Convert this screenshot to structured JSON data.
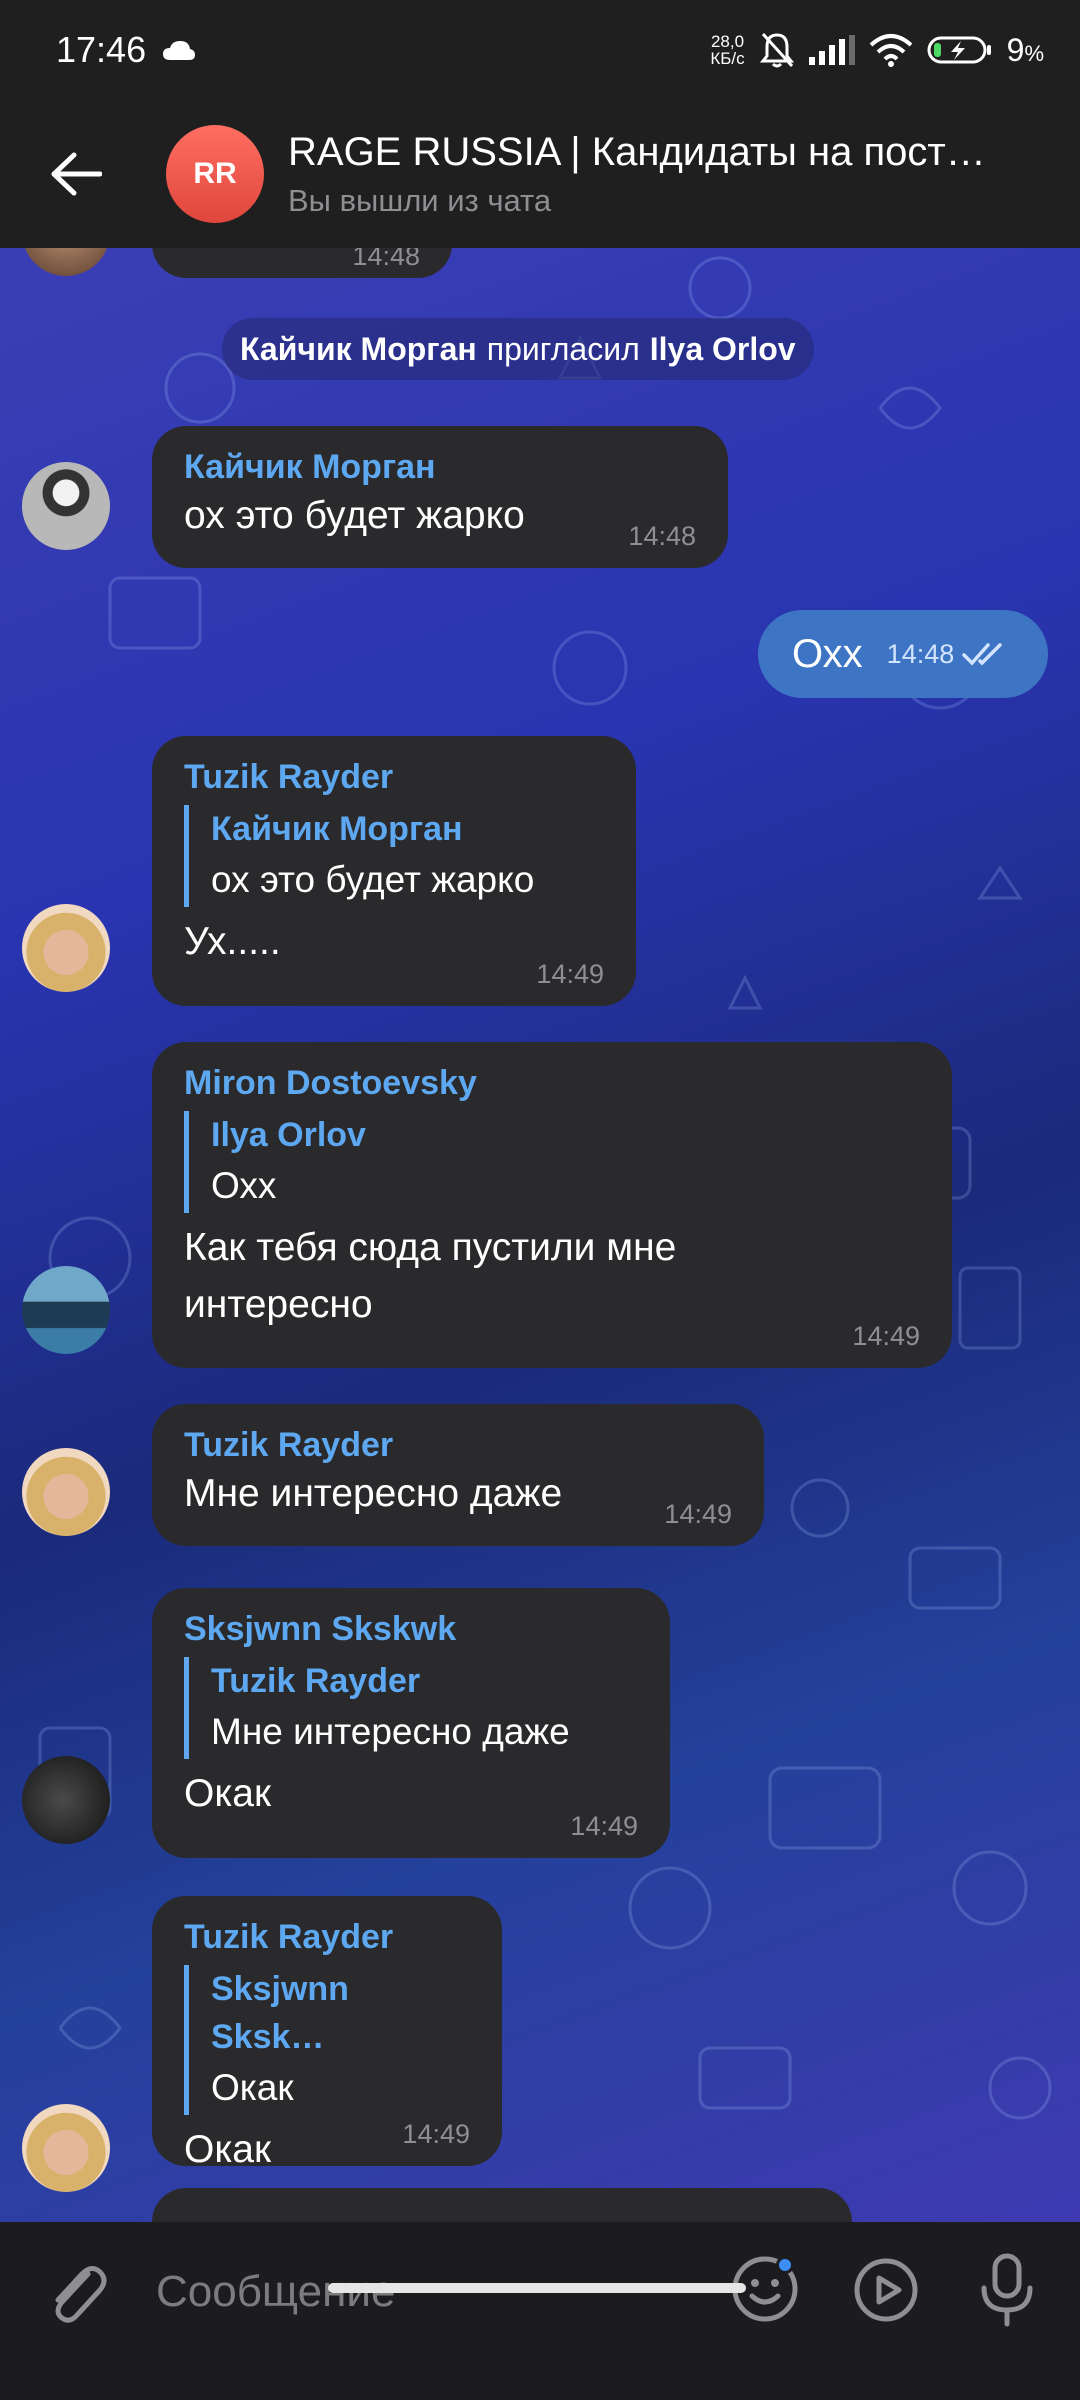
{
  "status_bar": {
    "time": "17:46",
    "net_speed_value": "28,0",
    "net_speed_unit": "КБ/с",
    "battery": "9",
    "battery_unit": "%"
  },
  "header": {
    "avatar_initials": "RR",
    "title": "RAGE RUSSIA | Кандидаты на пост…",
    "subtitle": "Вы вышли из чата"
  },
  "service_message": {
    "actor": "Кайчик Морган",
    "action": "пригласил",
    "target": "Ilya Orlov"
  },
  "top_partial_time": "14:48",
  "messages": [
    {
      "sender": "Кайчик Морган",
      "text": "ох это будет жарко",
      "time": "14:48"
    },
    {
      "text": "Охх",
      "time": "14:48",
      "status": "read-double-check"
    },
    {
      "sender": "Tuzik Rayder",
      "reply_to": "Кайчик Морган",
      "reply_text": "ох это будет жарко",
      "text": "Ух.....",
      "time": "14:49"
    },
    {
      "sender": "Miron Dostoevsky",
      "reply_to": "Ilya Orlov",
      "reply_text": "Охх",
      "text_line1": "Как тебя сюда пустили мне",
      "text_line2": "интересно",
      "time": "14:49"
    },
    {
      "sender": "Tuzik Rayder",
      "text": "Мне интересно даже",
      "time": "14:49"
    },
    {
      "sender": "Sksjwnn Skskwk",
      "reply_to": "Tuzik Rayder",
      "reply_text": "Мне интересно даже",
      "text": "Окак",
      "time": "14:49"
    },
    {
      "sender": "Tuzik Rayder",
      "reply_to": "Sksjwnn Sksk…",
      "reply_text": "Окак",
      "text": "Окак",
      "time": "14:49"
    }
  ],
  "input_bar": {
    "placeholder": "Сообщение"
  },
  "colors": {
    "sender_name": "#5da8f0",
    "incoming_bubble": "#2a2a2d",
    "outgoing_bubble": "#3d74c4",
    "header_bg": "#1f1f1f",
    "avatar": "#e85a4f",
    "unread_dot": "#3a8ef6"
  },
  "icons": [
    "back-arrow-icon",
    "cloud-icon",
    "muted-bell-icon",
    "signal-icon",
    "wifi-icon",
    "battery-charging-icon",
    "double-check-icon",
    "paperclip-icon",
    "emoji-icon",
    "video-message-icon",
    "microphone-icon"
  ]
}
